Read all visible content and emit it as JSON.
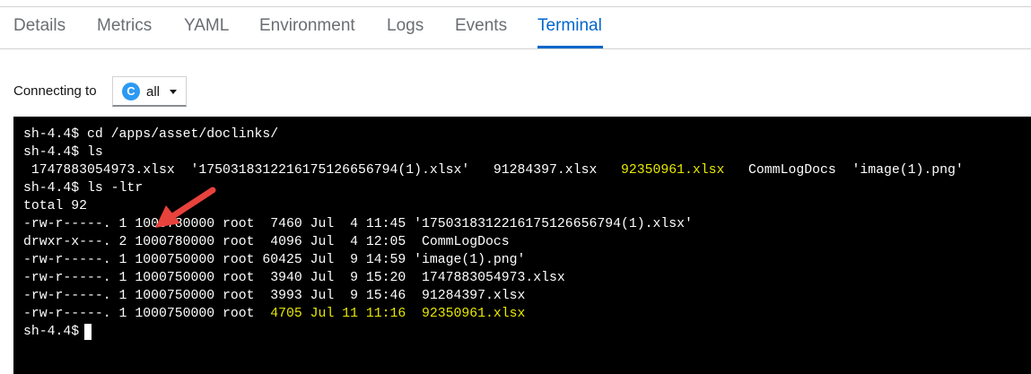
{
  "tabs": [
    {
      "label": "Details",
      "active": false
    },
    {
      "label": "Metrics",
      "active": false
    },
    {
      "label": "YAML",
      "active": false
    },
    {
      "label": "Environment",
      "active": false
    },
    {
      "label": "Logs",
      "active": false
    },
    {
      "label": "Events",
      "active": false
    },
    {
      "label": "Terminal",
      "active": true
    }
  ],
  "connection": {
    "label": "Connecting to",
    "badge": "C",
    "value": "all"
  },
  "terminal": {
    "lines": [
      {
        "text": "sh-4.4$ cd /apps/asset/doclinks/"
      },
      {
        "text": "sh-4.4$ ls"
      },
      {
        "parts": [
          " 1747883054973.xlsx  '1750318312216175126656794(1).xlsx'   91284397.xlsx   ",
          "92350961.xlsx",
          "   CommLogDocs  'image(1).png'"
        ]
      },
      {
        "text": "sh-4.4$ ls -ltr"
      },
      {
        "text": "total 92"
      },
      {
        "text": "-rw-r-----. 1 1000780000 root  7460 Jul  4 11:45 '1750318312216175126656794(1).xlsx'"
      },
      {
        "text": "drwxr-x---. 2 1000780000 root  4096 Jul  4 12:05  CommLogDocs"
      },
      {
        "text": "-rw-r-----. 1 1000750000 root 60425 Jul  9 14:59 'image(1).png'"
      },
      {
        "text": "-rw-r-----. 1 1000750000 root  3940 Jul  9 15:20  1747883054973.xlsx"
      },
      {
        "text": "-rw-r-----. 1 1000750000 root  3993 Jul  9 15:46  91284397.xlsx"
      },
      {
        "parts": [
          "-rw-r-----. 1 1000750000 root  ",
          "4705 Jul 11 11:16  92350961.xlsx"
        ]
      },
      {
        "text": "sh-4.4$ "
      }
    ]
  },
  "colors": {
    "accent": "#0066cc",
    "highlight": "#e8e800",
    "annotation_arrow": "#e8423c"
  }
}
